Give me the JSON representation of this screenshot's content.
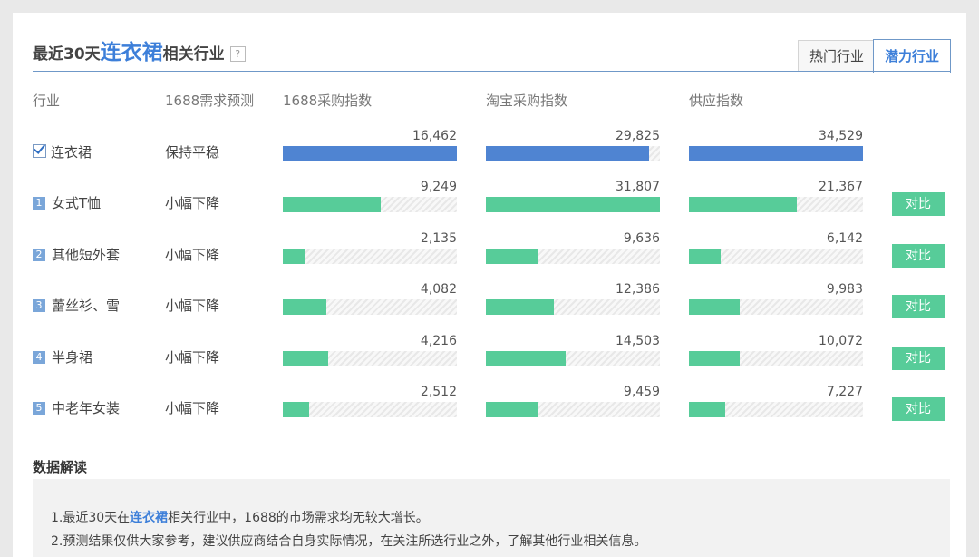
{
  "header": {
    "title_prefix": "最近30天",
    "keyword": "连衣裙",
    "title_suffix": "相关行业",
    "help_icon": "?",
    "tabs": [
      {
        "label": "热门行业",
        "active": false
      },
      {
        "label": "潜力行业",
        "active": true
      }
    ]
  },
  "columns": [
    "行业",
    "1688需求预测",
    "1688采购指数",
    "淘宝采购指数",
    "供应指数"
  ],
  "colors": {
    "selected_bar": "#4f84d2",
    "bar": "#57cc99",
    "accent": "#3d7fd9"
  },
  "rows": [
    {
      "rank": "",
      "checked": true,
      "name": "连衣裙",
      "forecast": "保持平稳",
      "purchase": {
        "label": "16,462",
        "fraction": 1.0
      },
      "taobao": {
        "label": "29,825",
        "fraction": 0.94
      },
      "supply": {
        "label": "34,529",
        "fraction": 1.0
      },
      "compare": ""
    },
    {
      "rank": "1",
      "checked": false,
      "name": "女式T恤",
      "forecast": "小幅下降",
      "purchase": {
        "label": "9,249",
        "fraction": 0.56
      },
      "taobao": {
        "label": "31,807",
        "fraction": 1.0
      },
      "supply": {
        "label": "21,367",
        "fraction": 0.62
      },
      "compare": "对比"
    },
    {
      "rank": "2",
      "checked": false,
      "name": "其他短外套",
      "forecast": "小幅下降",
      "purchase": {
        "label": "2,135",
        "fraction": 0.13
      },
      "taobao": {
        "label": "9,636",
        "fraction": 0.3
      },
      "supply": {
        "label": "6,142",
        "fraction": 0.18
      },
      "compare": "对比"
    },
    {
      "rank": "3",
      "checked": false,
      "name": "蕾丝衫、雪",
      "forecast": "小幅下降",
      "purchase": {
        "label": "4,082",
        "fraction": 0.25
      },
      "taobao": {
        "label": "12,386",
        "fraction": 0.39
      },
      "supply": {
        "label": "9,983",
        "fraction": 0.29
      },
      "compare": "对比"
    },
    {
      "rank": "4",
      "checked": false,
      "name": "半身裙",
      "forecast": "小幅下降",
      "purchase": {
        "label": "4,216",
        "fraction": 0.26
      },
      "taobao": {
        "label": "14,503",
        "fraction": 0.46
      },
      "supply": {
        "label": "10,072",
        "fraction": 0.29
      },
      "compare": "对比"
    },
    {
      "rank": "5",
      "checked": false,
      "name": "中老年女装",
      "forecast": "小幅下降",
      "purchase": {
        "label": "2,512",
        "fraction": 0.15
      },
      "taobao": {
        "label": "9,459",
        "fraction": 0.3
      },
      "supply": {
        "label": "7,227",
        "fraction": 0.21
      },
      "compare": "对比"
    }
  ],
  "interpretation": {
    "title": "数据解读",
    "line1_prefix": "1.最近30天在",
    "line1_keyword": "连衣裙",
    "line1_suffix": "相关行业中，1688的市场需求均无较大增长。",
    "line2": "2.预测结果仅供大家参考，建议供应商结合自身实际情况，在关注所选行业之外，了解其他行业相关信息。"
  }
}
